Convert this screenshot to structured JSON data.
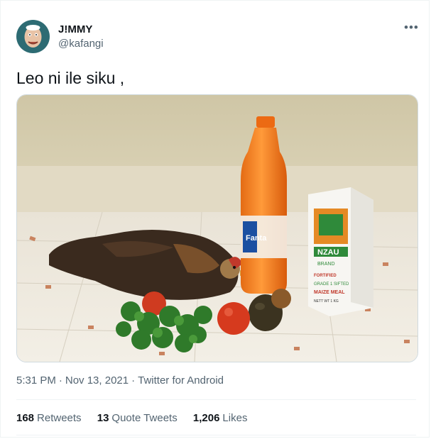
{
  "author": {
    "display_name": "J!MMY",
    "handle": "@kafangi",
    "avatar_color": "#2d6b73"
  },
  "menu_icon": "more-horizontal-icon",
  "tweet": {
    "text": "Leo ni ile siku ,",
    "image": {
      "bottle_label": "Fanta",
      "bag_brand_top": "NZAU",
      "bag_brand_bottom": "BRAND",
      "bag_line1": "FORTIFIED",
      "bag_line2": "GRADE 1 SIFTED",
      "bag_line3": "MAIZE MEAL",
      "bag_weight": "NETT WT 1 KG"
    }
  },
  "meta": {
    "time": "5:31 PM",
    "date": "Nov 13, 2021",
    "source": "Twitter for Android"
  },
  "stats": {
    "retweets_count": "168",
    "retweets_label": "Retweets",
    "quotes_count": "13",
    "quotes_label": "Quote Tweets",
    "likes_count": "1,206",
    "likes_label": "Likes"
  },
  "colors": {
    "secondary_text": "#536471",
    "border": "#eff3f4"
  }
}
